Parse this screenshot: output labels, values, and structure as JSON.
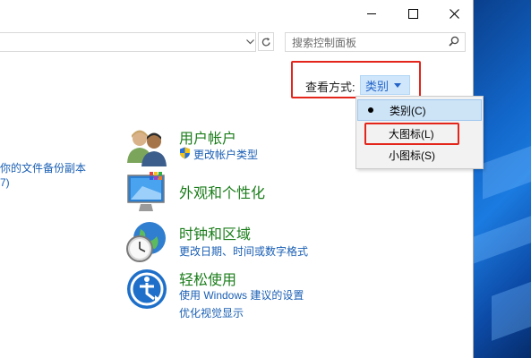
{
  "window": {
    "icons": [
      "minimize-icon",
      "maximize-icon",
      "close-icon"
    ]
  },
  "address_bar": {
    "dropdown_icon": "chevron-down-icon",
    "refresh_icon": "refresh-icon"
  },
  "search": {
    "placeholder": "搜索控制面板",
    "icon": "search-icon"
  },
  "view_by": {
    "label": "查看方式:",
    "value": "类别"
  },
  "view_menu": {
    "items": [
      {
        "label": "类别(C)",
        "selected": true
      },
      {
        "label": "大图标(L)",
        "selected": false
      },
      {
        "label": "小图标(S)",
        "selected": false
      }
    ]
  },
  "left_partial": {
    "line1": "你的文件备份副本",
    "line2": "7)"
  },
  "categories": [
    {
      "title": "用户帐户",
      "icon": "users-icon",
      "links": [
        {
          "label": "更改帐户类型",
          "shield": true
        }
      ]
    },
    {
      "title": "外观和个性化",
      "icon": "monitor-personalize-icon",
      "links": []
    },
    {
      "title": "时钟和区域",
      "icon": "clock-globe-icon",
      "links": [
        {
          "label": "更改日期、时间或数字格式",
          "shield": false
        }
      ]
    },
    {
      "title": "轻松使用",
      "icon": "ease-of-access-icon",
      "links": [
        {
          "label": "使用 Windows 建议的设置",
          "shield": false
        },
        {
          "label": "优化视觉显示",
          "shield": false
        }
      ]
    }
  ],
  "colors": {
    "category_title": "#1b7d1b",
    "link": "#1a5fb4",
    "annotation_red": "#e3251b",
    "menu_selected": "#cde4f7"
  }
}
